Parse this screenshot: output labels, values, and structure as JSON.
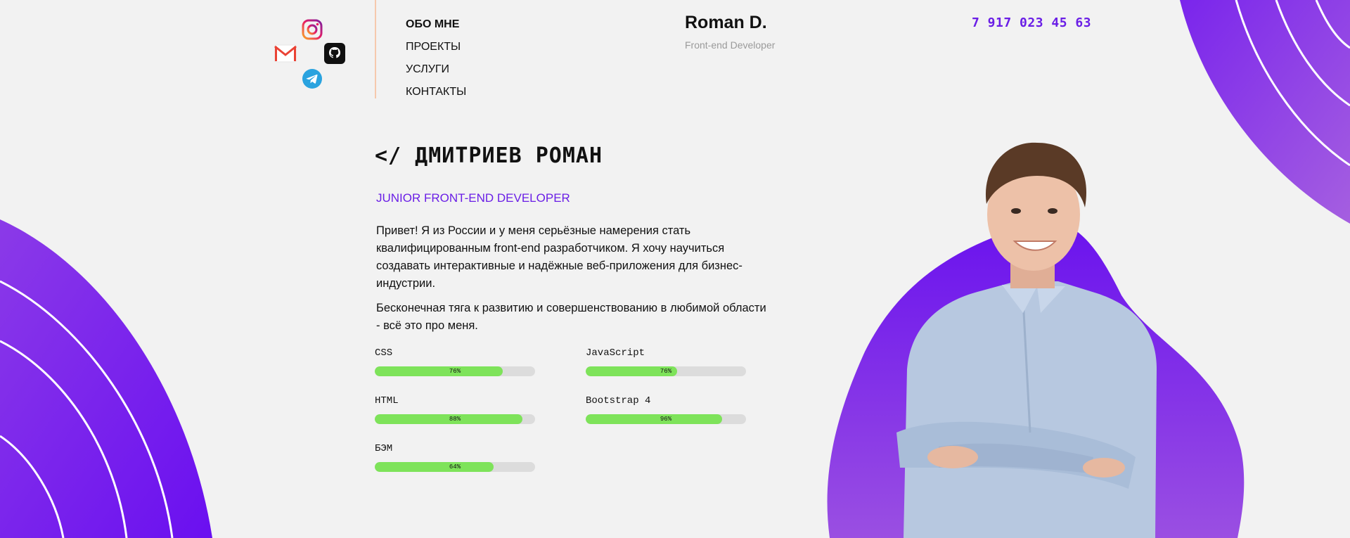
{
  "header": {
    "socials": [
      {
        "icon": "instagram-icon"
      },
      {
        "icon": "gmail-icon"
      },
      {
        "icon": "github-icon"
      },
      {
        "icon": "telegram-icon"
      }
    ],
    "nav": [
      "Обо мне",
      "Проекты",
      "Услуги",
      "Контакты"
    ],
    "brand_name": "Roman D.",
    "brand_subtitle": "Front-end Developer",
    "phone": "7 917 023 45 63"
  },
  "main": {
    "heading": "</ ДМИТРИЕВ РОМАН",
    "role": "JUNIOR FRONT-END DEVELOPER",
    "paragraphs": [
      "Привет! Я из России и у меня серьёзные намерения стать квалифицированным front-end разработчиком. Я хочу научиться создавать интерактивные и надёжные веб-приложения для бизнес-индустрии.",
      "Бесконечная тяга к развитию и совершенствованию в любимой области - всё это про меня."
    ],
    "skills": [
      {
        "name": "CSS",
        "label": "76%",
        "value": 0.8
      },
      {
        "name": "JavaScript",
        "label": "76%",
        "value": 0.57
      },
      {
        "name": "HTML",
        "label": "88%",
        "value": 0.92
      },
      {
        "name": "Bootstrap 4",
        "label": "96%",
        "value": 0.85
      },
      {
        "name": "БЭМ",
        "label": "64%",
        "value": 0.74
      }
    ]
  },
  "colors": {
    "accent": "#6a1ee6",
    "purple_light": "#9b50e6",
    "bar_fill": "#7ee35a",
    "bar_track": "#dcdcdc",
    "background": "#f2f2f2"
  }
}
